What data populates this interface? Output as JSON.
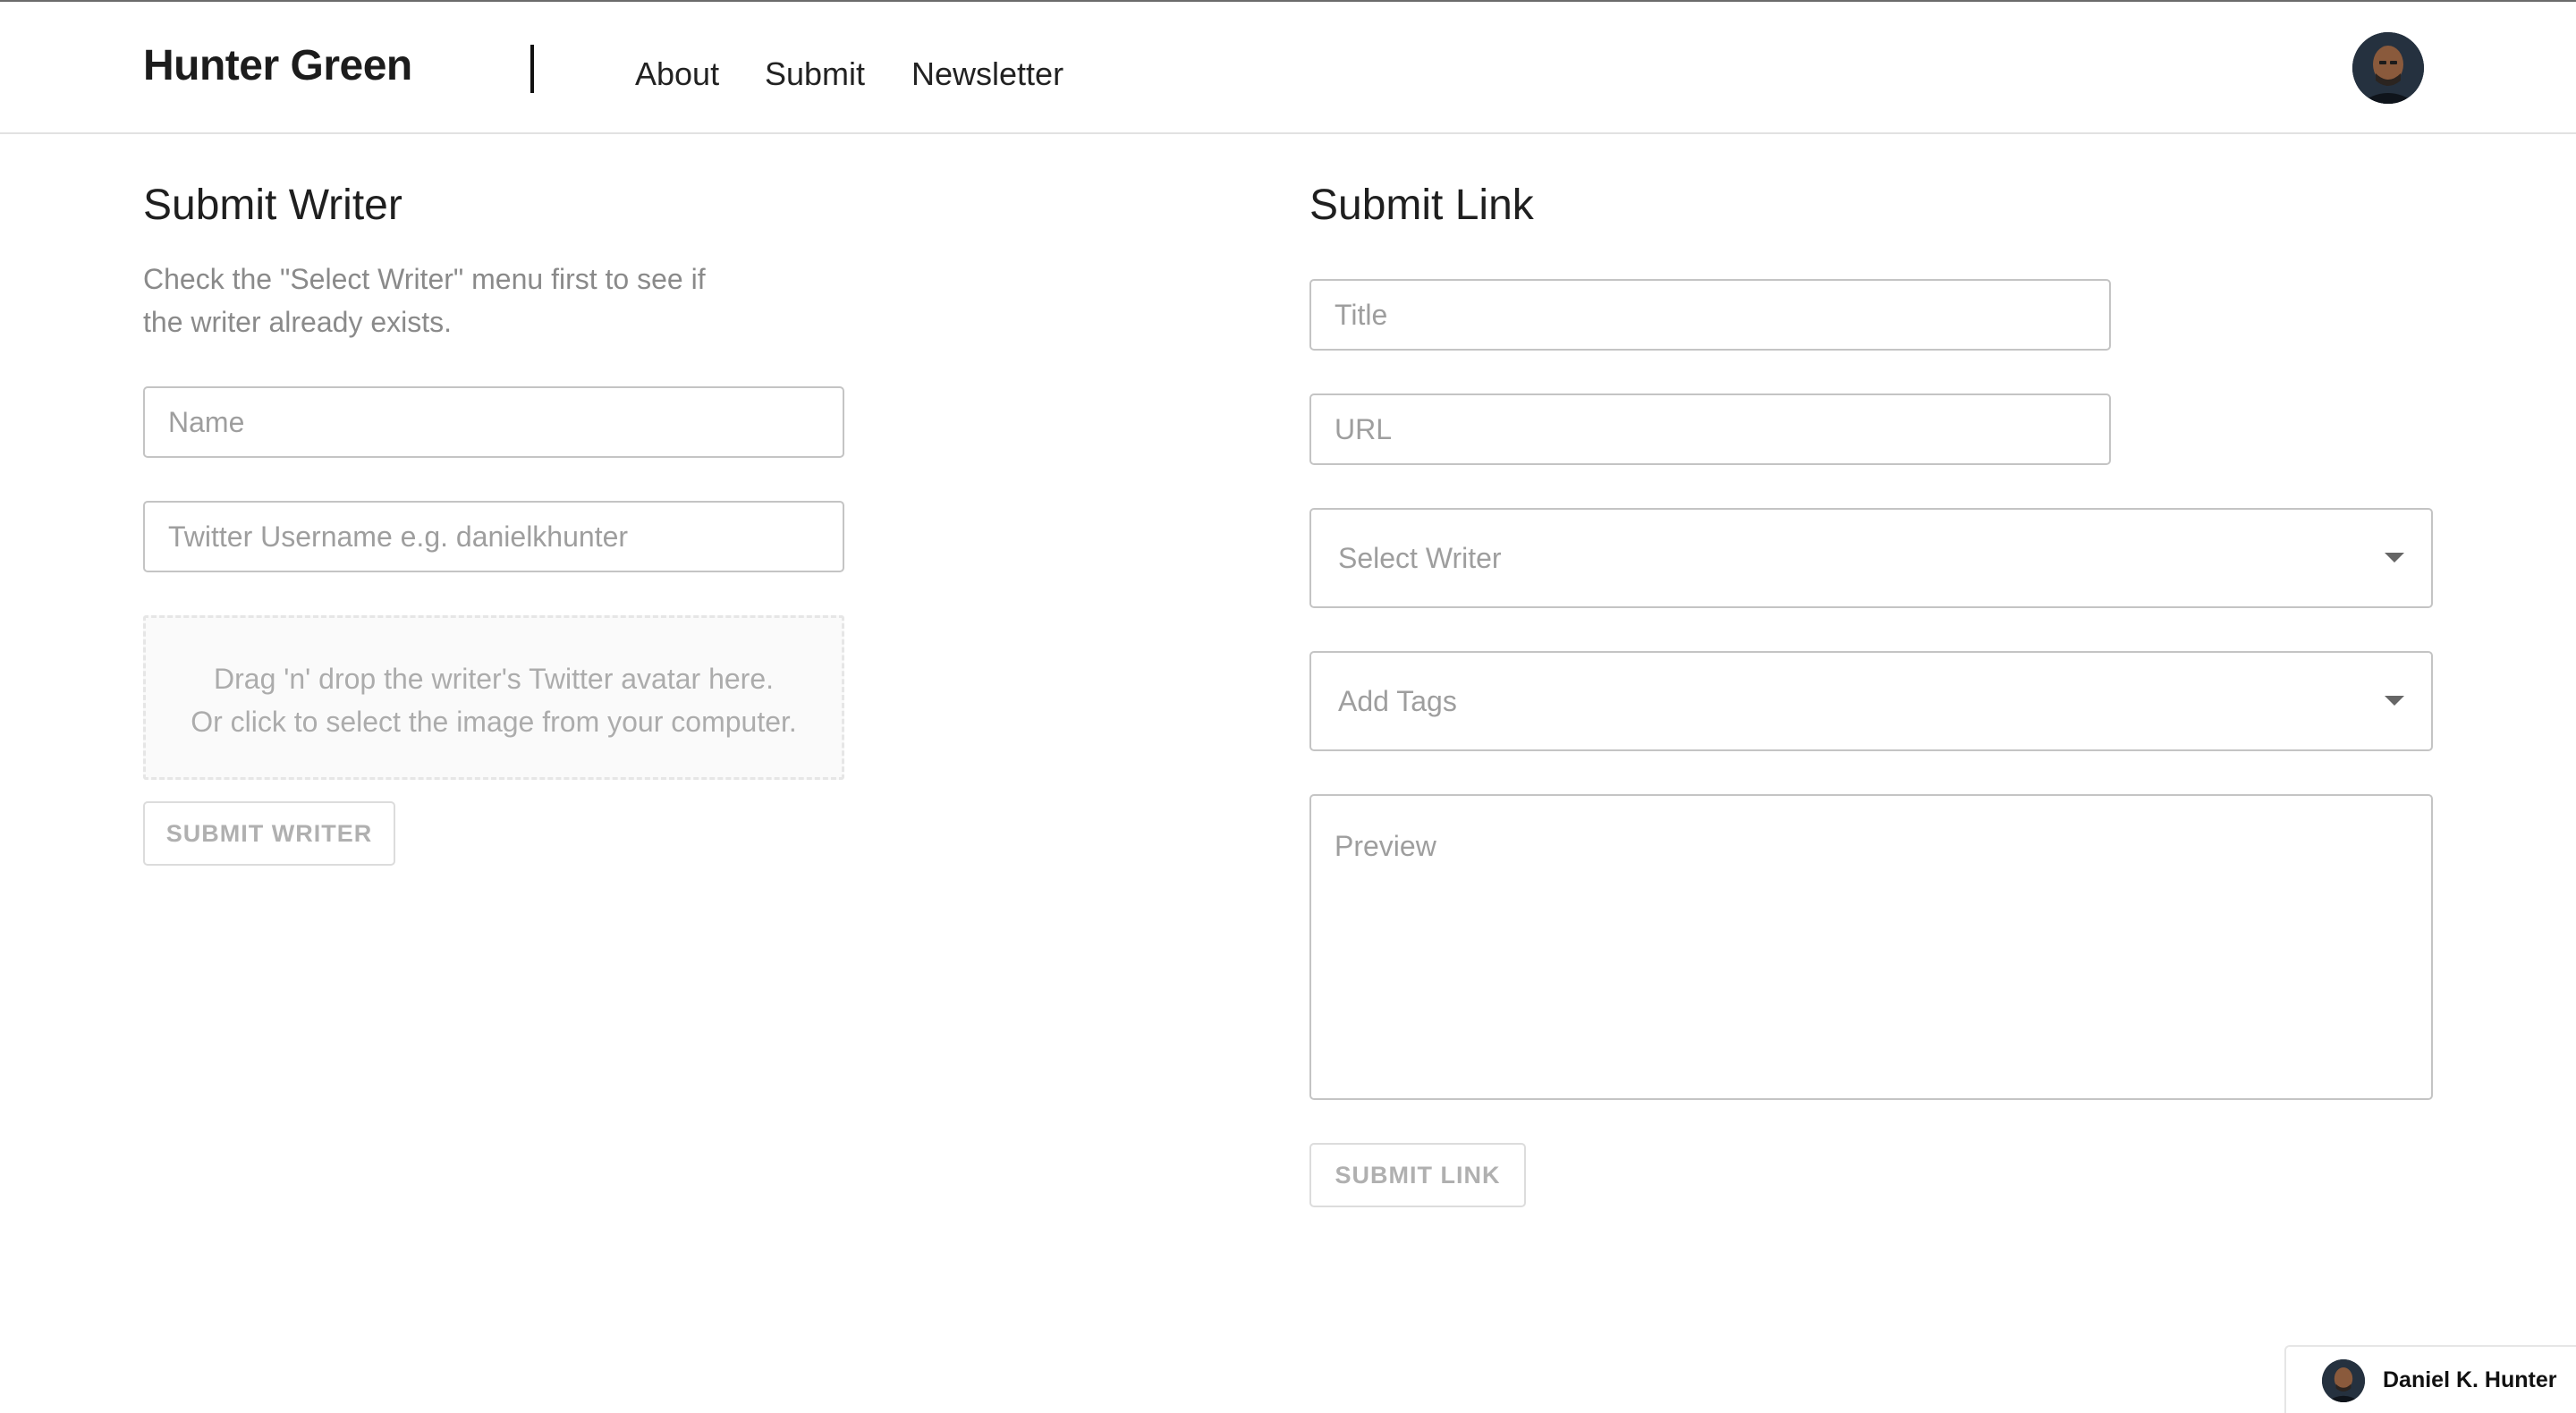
{
  "header": {
    "brand": "Hunter Green",
    "nav": {
      "about": "About",
      "submit": "Submit",
      "newsletter": "Newsletter"
    }
  },
  "submit_writer": {
    "title": "Submit Writer",
    "help_text": "Check the \"Select Writer\" menu first to see if the writer already exists.",
    "name_placeholder": "Name",
    "twitter_placeholder": "Twitter Username e.g. danielkhunter",
    "dropzone_line1": "Drag 'n' drop the writer's Twitter avatar here.",
    "dropzone_line2": "Or click to select the image from your computer.",
    "button_label": "SUBMIT WRITER"
  },
  "submit_link": {
    "title": "Submit Link",
    "title_placeholder": "Title",
    "url_placeholder": "URL",
    "select_writer_label": "Select Writer",
    "add_tags_label": "Add Tags",
    "preview_placeholder": "Preview",
    "button_label": "SUBMIT LINK"
  },
  "credit": {
    "name": "Daniel K. Hunter"
  },
  "colors": {
    "border": "#c4c4c4",
    "placeholder": "#9e9e9e",
    "disabled_text": "#b0b0b0"
  },
  "icons": {
    "dropdown": "chevron-down-icon"
  }
}
